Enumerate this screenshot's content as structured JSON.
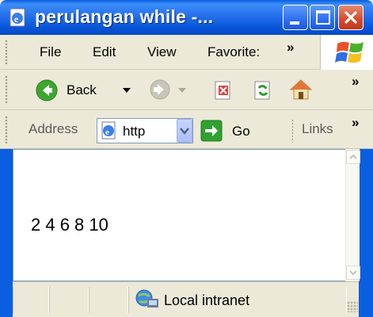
{
  "window": {
    "title": "perulangan while -...",
    "icons": {
      "app": "ie-page-icon",
      "minimize": "minimize-icon",
      "maximize": "maximize-icon",
      "close": "close-icon"
    }
  },
  "menu": {
    "items": [
      "File",
      "Edit",
      "View",
      "Favorite:"
    ],
    "overflow": "»"
  },
  "toolbar": {
    "back_label": "Back",
    "overflow": "»"
  },
  "address_bar": {
    "label": "Address",
    "value": "http",
    "go_label": "Go",
    "links_label": "Links",
    "links_overflow": "»"
  },
  "page": {
    "output": "2 4 6 8 10"
  },
  "status_bar": {
    "zone": "Local intranet"
  },
  "colors": {
    "titlebar": "#0a5fe0",
    "close": "#d6492a",
    "go_green": "#2ea12e",
    "chrome": "#ece9d8"
  }
}
